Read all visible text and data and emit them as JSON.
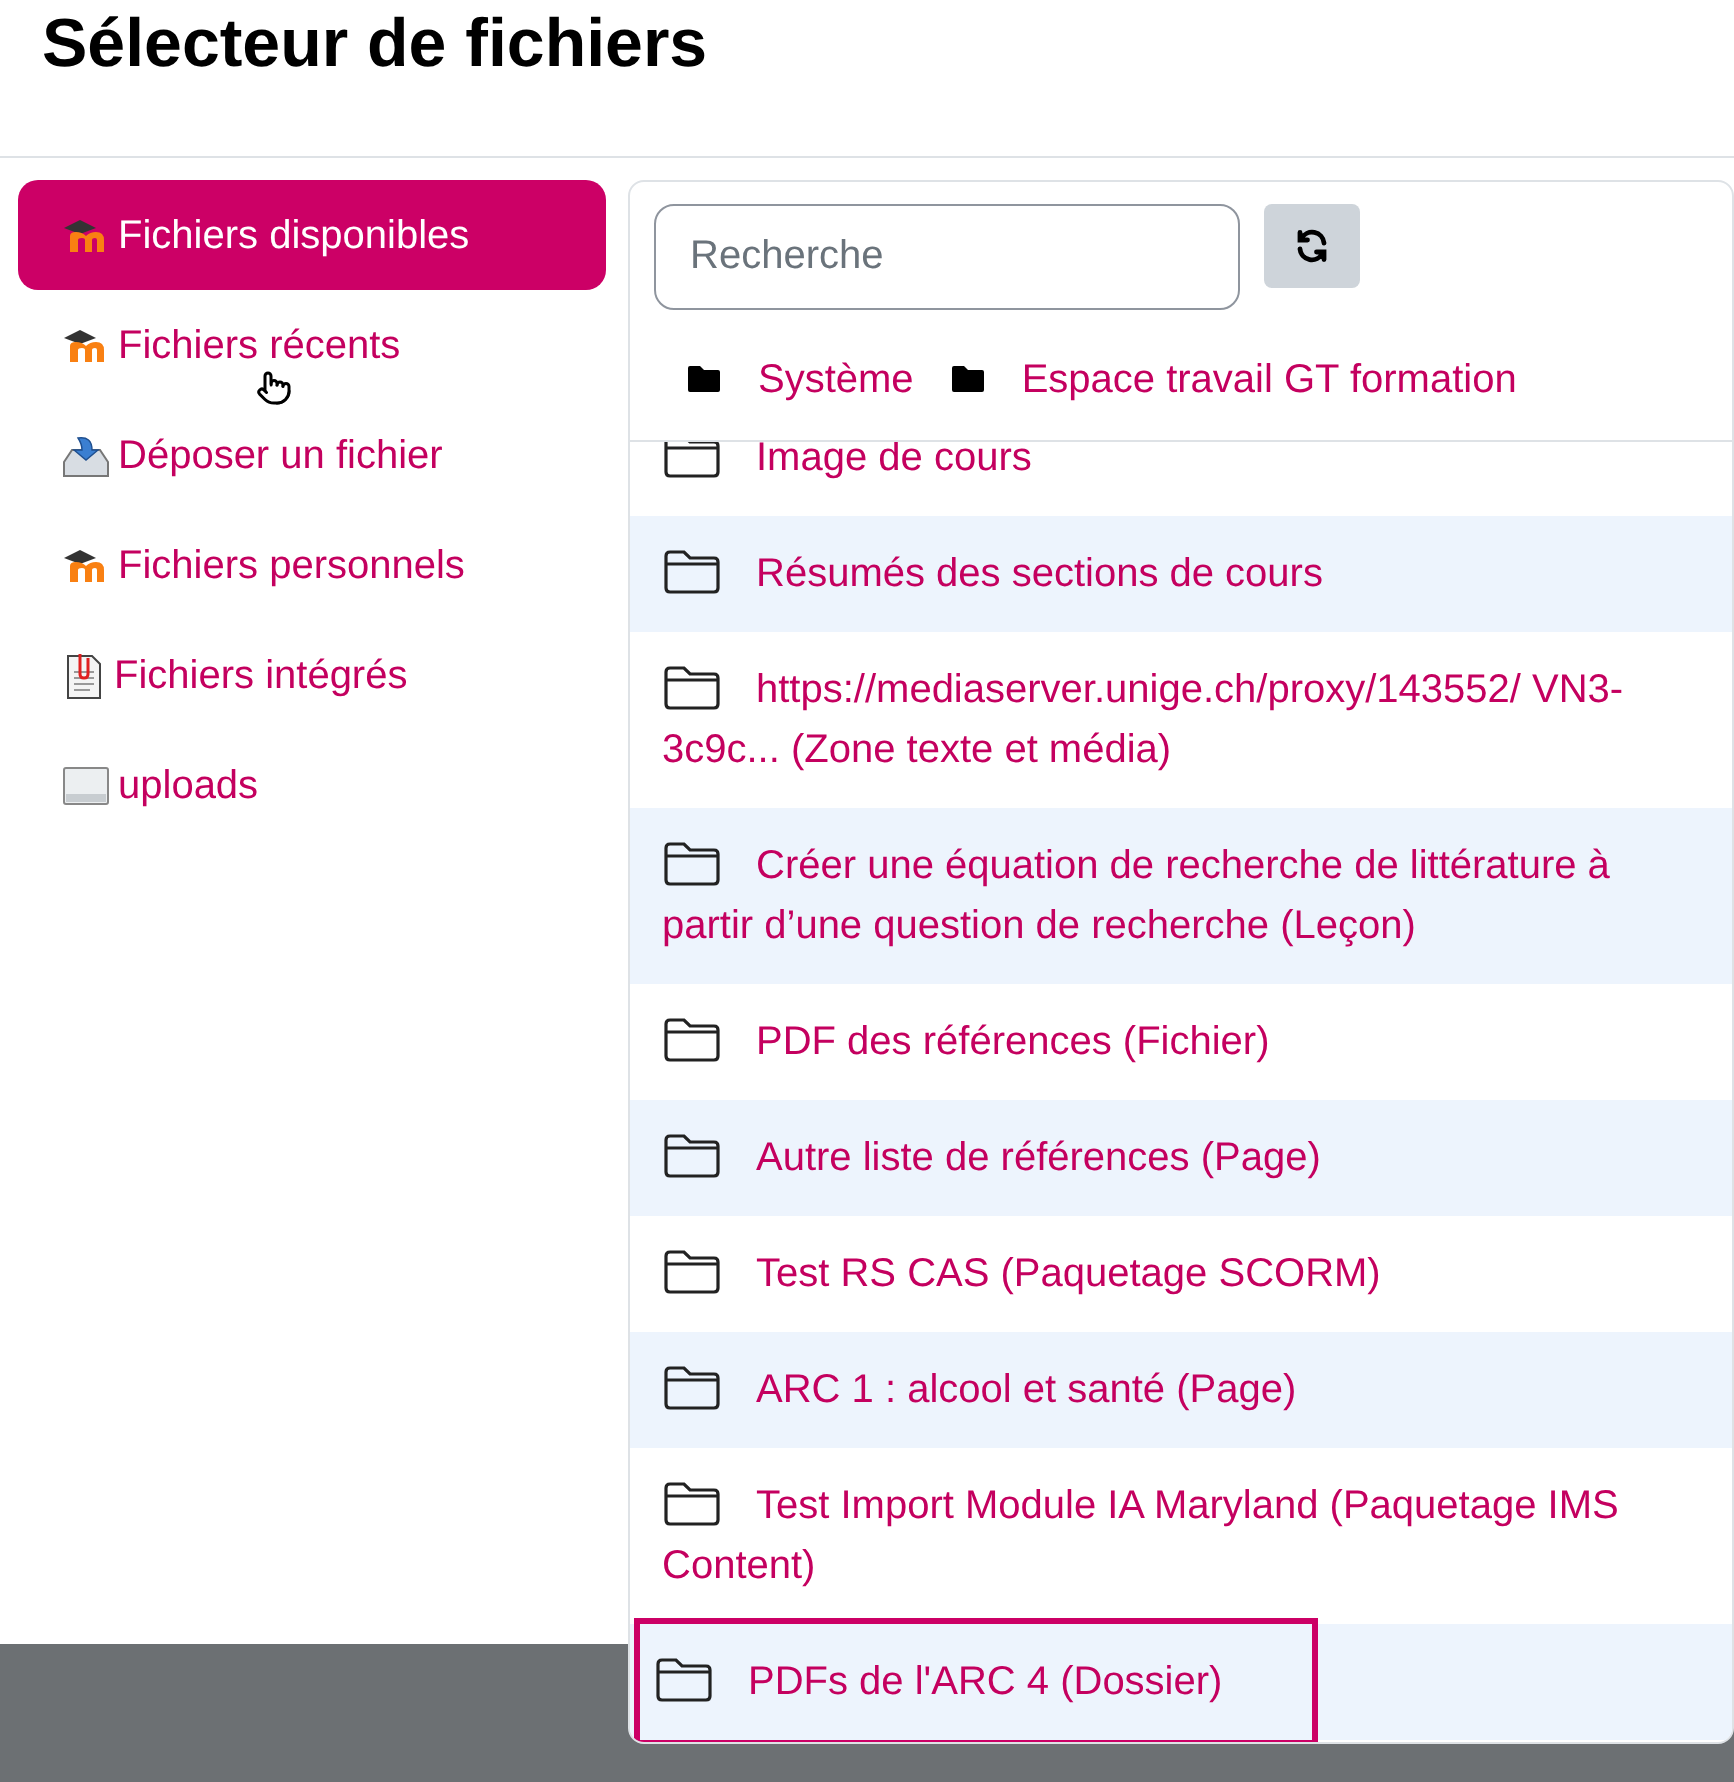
{
  "title": "Sélecteur de fichiers",
  "sidebar": {
    "items": [
      {
        "label": "Fichiers disponibles",
        "kind": "moodle",
        "selected": true
      },
      {
        "label": "Fichiers récents",
        "kind": "moodle",
        "selected": false
      },
      {
        "label": "Déposer un fichier",
        "kind": "upload",
        "selected": false
      },
      {
        "label": "Fichiers personnels",
        "kind": "moodle",
        "selected": false
      },
      {
        "label": "Fichiers intégrés",
        "kind": "embedded",
        "selected": false
      },
      {
        "label": "uploads",
        "kind": "drive",
        "selected": false
      }
    ]
  },
  "search": {
    "placeholder": "Recherche"
  },
  "breadcrumb": [
    "Système",
    "Espace travail GT formation"
  ],
  "files": [
    {
      "name": "Image de cours",
      "selected": false
    },
    {
      "name": "Résumés des sections de cours",
      "selected": false
    },
    {
      "name": "https://mediaserver.unige.ch/proxy/143552/ VN3-3c9c... (Zone texte et média)",
      "selected": false
    },
    {
      "name": "Créer une équation de recherche de littérature à partir d’une question de recherche (Leçon)",
      "selected": false
    },
    {
      "name": "PDF des références (Fichier)",
      "selected": false
    },
    {
      "name": "Autre liste de références (Page)",
      "selected": false
    },
    {
      "name": "Test RS CAS (Paquetage SCORM)",
      "selected": false
    },
    {
      "name": "ARC 1 : alcool et santé (Page)",
      "selected": false
    },
    {
      "name": "Test Import Module IA Maryland (Paquetage IMS Content)",
      "selected": false
    },
    {
      "name": "PDFs de l'ARC 4 (Dossier)",
      "selected": true
    }
  ]
}
